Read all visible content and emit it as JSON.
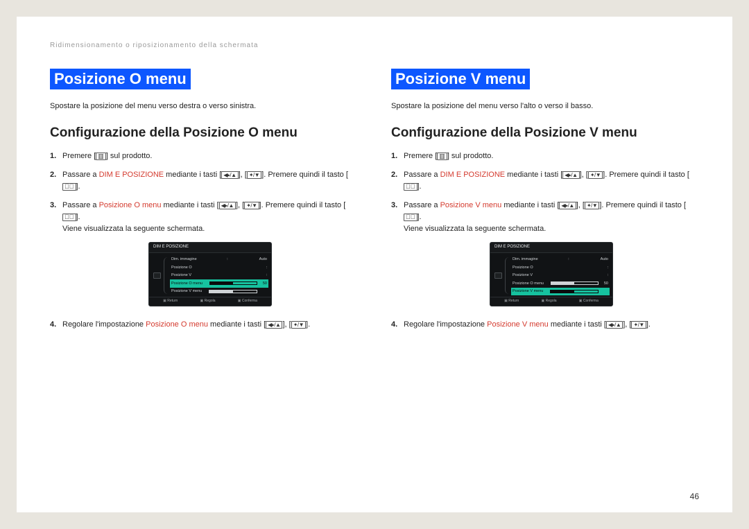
{
  "breadcrumb": "Ridimensionamento o riposizionamento della schermata",
  "page_number": "46",
  "left": {
    "title": "Posizione O menu",
    "desc": "Spostare la posizione del menu verso destra o verso sinistra.",
    "subtitle": "Configurazione della Posizione O menu",
    "steps": {
      "s1_a": "Premere [",
      "s1_b": "] sul prodotto.",
      "s2_a": "Passare a ",
      "s2_hl": "DIM E POSIZIONE",
      "s2_b": " mediante i tasti [",
      "s2_c": "], [",
      "s2_d": "]. Premere quindi il tasto [",
      "s2_e": "].",
      "s3_a": "Passare a ",
      "s3_hl": "Posizione O menu",
      "s3_b": " mediante i tasti [",
      "s3_c": "], [",
      "s3_d": "]. Premere quindi il tasto [",
      "s3_e": "].",
      "s3_f": "Viene visualizzata la seguente schermata.",
      "s4_a": "Regolare l'impostazione ",
      "s4_hl": "Posizione O menu",
      "s4_b": " mediante i tasti [",
      "s4_c": "], [",
      "s4_d": "]."
    },
    "osd": {
      "head": "DIM E POSIZIONE",
      "rows": [
        {
          "label": "Dim. immagine",
          "value": "Auto"
        },
        {
          "label": "Posizione O"
        },
        {
          "label": "Posizione V"
        },
        {
          "label": "Posizione O menu",
          "slider": 50,
          "val": "50",
          "selected": true
        },
        {
          "label": "Posizione V menu",
          "slider": 50,
          "val": ""
        }
      ],
      "foot": [
        "Return",
        "Regola",
        "Conferma"
      ]
    }
  },
  "right": {
    "title": "Posizione V menu",
    "desc": "Spostare la posizione del menu verso l'alto o verso il basso.",
    "subtitle": "Configurazione della Posizione V menu",
    "steps": {
      "s1_a": "Premere [",
      "s1_b": "] sul prodotto.",
      "s2_a": "Passare a ",
      "s2_hl": "DIM E POSIZIONE",
      "s2_b": " mediante i tasti [",
      "s2_c": "], [",
      "s2_d": "]. Premere quindi il tasto [",
      "s2_e": "].",
      "s3_a": "Passare a ",
      "s3_hl": "Posizione V menu",
      "s3_b": " mediante i tasti [",
      "s3_c": "], [",
      "s3_d": "]. Premere quindi il tasto [",
      "s3_e": "].",
      "s3_f": "Viene visualizzata la seguente schermata.",
      "s4_a": "Regolare l'impostazione ",
      "s4_hl": "Posizione V menu",
      "s4_b": " mediante i tasti [",
      "s4_c": "], [",
      "s4_d": "]."
    },
    "osd": {
      "head": "DIM E POSIZIONE",
      "rows": [
        {
          "label": "Dim. immagine",
          "value": "Auto"
        },
        {
          "label": "Posizione O"
        },
        {
          "label": "Posizione V"
        },
        {
          "label": "Posizione O menu",
          "slider": 50,
          "val": "50"
        },
        {
          "label": "Posizione V menu",
          "slider": 50,
          "val": "",
          "selected": true
        }
      ],
      "foot": [
        "Return",
        "Regola",
        "Conferma"
      ]
    }
  }
}
